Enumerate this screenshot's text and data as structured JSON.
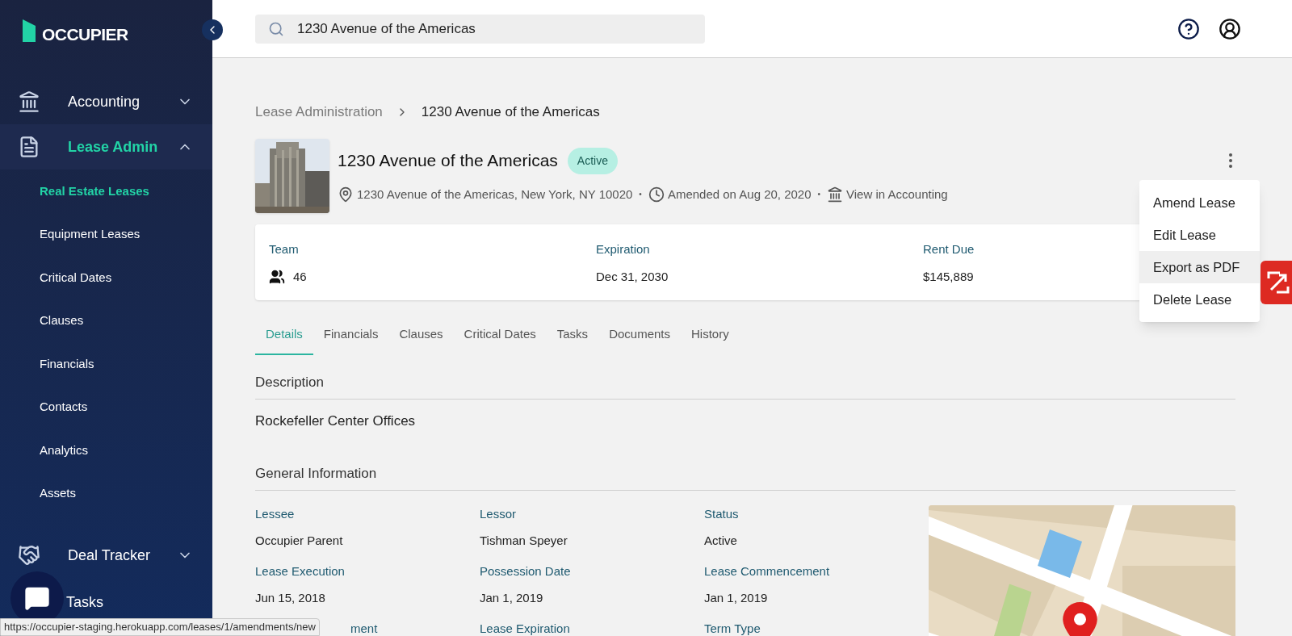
{
  "sidebar": {
    "logo": "OCCUPIER",
    "items": [
      {
        "label": "Accounting",
        "expanded": false,
        "selected": false
      },
      {
        "label": "Lease Admin",
        "expanded": true,
        "selected": true,
        "children": [
          {
            "label": "Real Estate Leases",
            "selected": true
          },
          {
            "label": "Equipment Leases",
            "selected": false
          },
          {
            "label": "Critical Dates",
            "selected": false
          },
          {
            "label": "Clauses",
            "selected": false
          },
          {
            "label": "Financials",
            "selected": false
          },
          {
            "label": "Contacts",
            "selected": false
          },
          {
            "label": "Analytics",
            "selected": false
          },
          {
            "label": "Assets",
            "selected": false
          }
        ]
      },
      {
        "label": "Deal Tracker",
        "expanded": false,
        "selected": false
      },
      {
        "label": "Tasks",
        "selected": false
      }
    ]
  },
  "search": {
    "value": "1230 Avenue of the Americas"
  },
  "breadcrumb": [
    "Lease Administration",
    "1230 Avenue of the Americas"
  ],
  "lease": {
    "title": "1230 Avenue of the Americas",
    "status": "Active",
    "separator": "•",
    "meta": [
      "1230 Avenue of the Americas, New York, NY 10020",
      "Amended on Aug 20, 2020",
      "View in Accounting"
    ]
  },
  "summary": [
    {
      "label": "Team",
      "value": "46"
    },
    {
      "label": "Expiration",
      "value": "Dec 31, 2030"
    },
    {
      "label": "Rent Due",
      "value": "$145,889"
    }
  ],
  "menu": [
    {
      "label": "Amend Lease",
      "selected": false
    },
    {
      "label": "Edit Lease",
      "selected": false
    },
    {
      "label": "Export as PDF",
      "selected": true
    },
    {
      "label": "Delete Lease",
      "selected": false
    }
  ],
  "tabs": [
    {
      "label": "Details",
      "selected": true
    },
    {
      "label": "Financials",
      "selected": false
    },
    {
      "label": "Clauses",
      "selected": false
    },
    {
      "label": "Critical Dates",
      "selected": false
    },
    {
      "label": "Tasks",
      "selected": false
    },
    {
      "label": "Documents",
      "selected": false
    },
    {
      "label": "History",
      "selected": false
    }
  ],
  "description": {
    "heading": "Description",
    "text": "Rockefeller Center Offices"
  },
  "general": {
    "heading": "General Information",
    "fields": [
      {
        "label": "Lessee",
        "value": "Occupier Parent"
      },
      {
        "label": "Lessor",
        "value": "Tishman Speyer"
      },
      {
        "label": "Status",
        "value": "Active"
      },
      {
        "label": "Lease Execution",
        "value": "Jun 15, 2018"
      },
      {
        "label": "Possession Date",
        "value": "Jan 1, 2019"
      },
      {
        "label": "Lease Commencement",
        "value": "Jan 1, 2019"
      },
      {
        "label": "ment"
      },
      {
        "label": "Lease Expiration"
      },
      {
        "label": "Term Type"
      }
    ]
  },
  "status_url": "https://occupier-staging.herokuapp.com/leases/1/amendments/new"
}
